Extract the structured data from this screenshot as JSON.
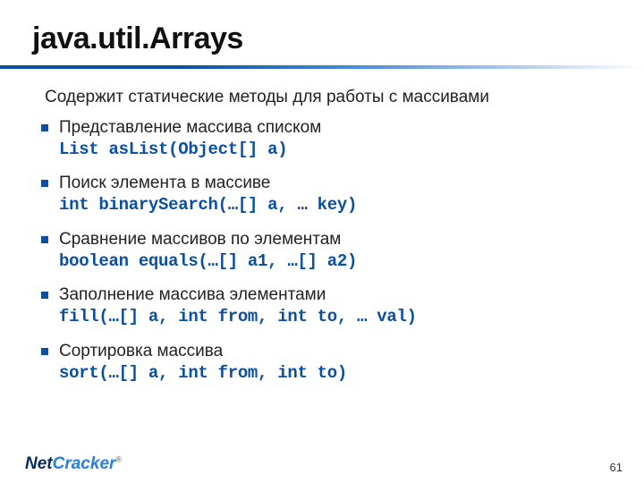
{
  "title": "java.util.Arrays",
  "intro": "Содержит статические методы для работы с массивами",
  "items": [
    {
      "desc": "Представление массива списком",
      "code": "List asList(Object[] a)"
    },
    {
      "desc": "Поиск элемента в массиве",
      "code": "int binarySearch(…[] a, … key)"
    },
    {
      "desc": "Сравнение массивов по элементам",
      "code": "boolean equals(…[] a1, …[] a2)"
    },
    {
      "desc": "Заполнение массива элементами",
      "code": "fill(…[] a, int from, int to, … val)"
    },
    {
      "desc": "Сортировка массива",
      "code": "sort(…[] a, int from, int to)"
    }
  ],
  "footer": {
    "logo_part1": "Net",
    "logo_part2": "Cracker",
    "logo_reg": "®",
    "page": "61"
  }
}
